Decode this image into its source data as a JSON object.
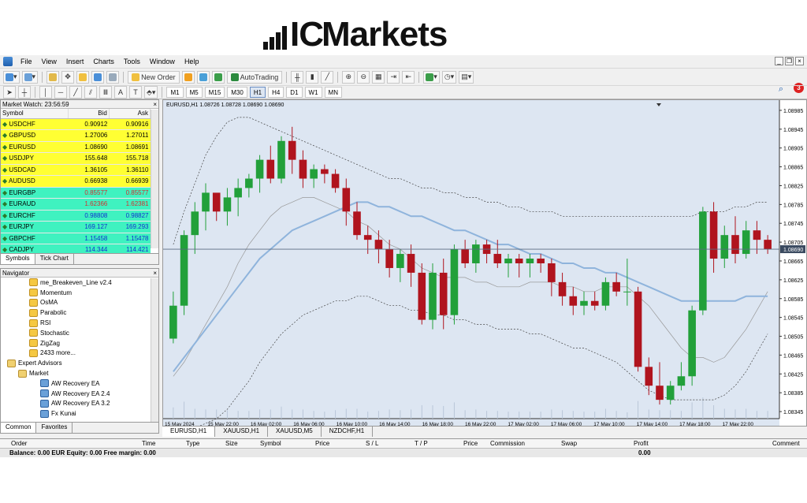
{
  "logo": {
    "prefix": "IC",
    "text": "Markets"
  },
  "menu": [
    "File",
    "View",
    "Insert",
    "Charts",
    "Tools",
    "Window",
    "Help"
  ],
  "toolbar": {
    "new_order": "New Order",
    "auto_trading": "AutoTrading"
  },
  "timeframes": [
    "M1",
    "M5",
    "M15",
    "M30",
    "H1",
    "H4",
    "D1",
    "W1",
    "MN"
  ],
  "active_timeframe": "H1",
  "market_watch": {
    "title": "Market Watch: 23:56:59",
    "headers": {
      "symbol": "Symbol",
      "bid": "Bid",
      "ask": "Ask"
    },
    "rows": [
      {
        "symbol": "USDCHF",
        "bid": "0.90912",
        "ask": "0.90916",
        "bg": "#ffff33",
        "fg": "#000"
      },
      {
        "symbol": "GBPUSD",
        "bid": "1.27006",
        "ask": "1.27011",
        "bg": "#ffff33",
        "fg": "#000"
      },
      {
        "symbol": "EURUSD",
        "bid": "1.08690",
        "ask": "1.08691",
        "bg": "#ffff33",
        "fg": "#000"
      },
      {
        "symbol": "USDJPY",
        "bid": "155.648",
        "ask": "155.718",
        "bg": "#ffff33",
        "fg": "#000"
      },
      {
        "symbol": "USDCAD",
        "bid": "1.36105",
        "ask": "1.36110",
        "bg": "#ffff33",
        "fg": "#000"
      },
      {
        "symbol": "AUDUSD",
        "bid": "0.66938",
        "ask": "0.66939",
        "bg": "#ffff33",
        "fg": "#000"
      },
      {
        "symbol": "EURGBP",
        "bid": "0.85577",
        "ask": "0.85577",
        "bg": "#3ff2c0",
        "fg": "#d03030"
      },
      {
        "symbol": "EURAUD",
        "bid": "1.62366",
        "ask": "1.62381",
        "bg": "#3ff2c0",
        "fg": "#d03030"
      },
      {
        "symbol": "EURCHF",
        "bid": "0.98808",
        "ask": "0.98827",
        "bg": "#3ff2c0",
        "fg": "#1030d0"
      },
      {
        "symbol": "EURJPY",
        "bid": "169.127",
        "ask": "169.293",
        "bg": "#3ff2c0",
        "fg": "#1030d0"
      },
      {
        "symbol": "GBPCHF",
        "bid": "1.15458",
        "ask": "1.15478",
        "bg": "#3ff2c0",
        "fg": "#1030d0"
      },
      {
        "symbol": "CADJPY",
        "bid": "114.344",
        "ask": "114.421",
        "bg": "#3ff2c0",
        "fg": "#1030d0"
      }
    ],
    "tabs": [
      "Symbols",
      "Tick Chart"
    ]
  },
  "navigator": {
    "title": "Navigator",
    "items": [
      {
        "label": "me_Breakeven_Line v2.4",
        "indent": 36,
        "type": "ind"
      },
      {
        "label": "Momentum",
        "indent": 36,
        "type": "ind"
      },
      {
        "label": "OsMA",
        "indent": 36,
        "type": "ind"
      },
      {
        "label": "Parabolic",
        "indent": 36,
        "type": "ind"
      },
      {
        "label": "RSI",
        "indent": 36,
        "type": "ind"
      },
      {
        "label": "Stochastic",
        "indent": 36,
        "type": "ind"
      },
      {
        "label": "ZigZag",
        "indent": 36,
        "type": "ind"
      },
      {
        "label": "2433 more...",
        "indent": 36,
        "type": "ind"
      },
      {
        "label": "Expert Advisors",
        "indent": 8,
        "type": "fold"
      },
      {
        "label": "Market",
        "indent": 22,
        "type": "fold"
      },
      {
        "label": "AW Recovery EA",
        "indent": 50,
        "type": "ea"
      },
      {
        "label": "AW Recovery EA 2.4",
        "indent": 50,
        "type": "ea"
      },
      {
        "label": "AW Recovery EA 3.2",
        "indent": 50,
        "type": "ea"
      },
      {
        "label": "Fx Kunai",
        "indent": 50,
        "type": "ea"
      }
    ],
    "tabs": [
      "Common",
      "Favorites"
    ]
  },
  "chart": {
    "title": "EURUSD,H1  1.08726 1.08728 1.08690 1.08690",
    "price_labels": [
      "1.08985",
      "1.08945",
      "1.08905",
      "1.08865",
      "1.08825",
      "1.08785",
      "1.08745",
      "1.08705",
      "1.08665",
      "1.08625",
      "1.08585",
      "1.08545",
      "1.08505",
      "1.08465",
      "1.08425",
      "1.08385",
      "1.08345"
    ],
    "current_price": "1.08690",
    "time_labels": [
      "15 May 2024",
      "15 May 22:00",
      "16 May 02:00",
      "16 May 06:00",
      "16 May 10:00",
      "16 May 14:00",
      "16 May 18:00",
      "16 May 22:00",
      "17 May 02:00",
      "17 May 06:00",
      "17 May 10:00",
      "17 May 14:00",
      "17 May 18:00",
      "17 May 22:00"
    ],
    "colors": {
      "bg": "#dde6f2",
      "bull": "#22a03a",
      "bear": "#b0141e",
      "ma": "#8fb4dc"
    },
    "tabs": [
      "EURUSD,H1",
      "XAUUSD,H1",
      "XAUUSD,M5",
      "NZDCHF,H1"
    ]
  },
  "chart_data": {
    "type": "line",
    "symbol": "EURUSD",
    "timeframe": "H1",
    "ylim": [
      1.0833,
      1.09
    ],
    "candles": [
      [
        1.085,
        1.086,
        1.0849,
        1.0857
      ],
      [
        1.0857,
        1.0873,
        1.0855,
        1.0872
      ],
      [
        1.0872,
        1.0879,
        1.0868,
        1.0877
      ],
      [
        1.0877,
        1.0883,
        1.0873,
        1.0881
      ],
      [
        1.0881,
        1.088,
        1.0875,
        1.0877
      ],
      [
        1.0877,
        1.0882,
        1.0874,
        1.088
      ],
      [
        1.088,
        1.0884,
        1.0876,
        1.0882
      ],
      [
        1.0882,
        1.0885,
        1.088,
        1.0884
      ],
      [
        1.0884,
        1.0889,
        1.0881,
        1.0888
      ],
      [
        1.0888,
        1.0891,
        1.0883,
        1.0884
      ],
      [
        1.0884,
        1.0893,
        1.0883,
        1.0892
      ],
      [
        1.0892,
        1.0895,
        1.0885,
        1.0888
      ],
      [
        1.0888,
        1.089,
        1.0882,
        1.0884
      ],
      [
        1.0884,
        1.0887,
        1.0882,
        1.0886
      ],
      [
        1.0886,
        1.0887,
        1.0883,
        1.0885
      ],
      [
        1.0885,
        1.0886,
        1.0881,
        1.0882
      ],
      [
        1.0882,
        1.0884,
        1.0874,
        1.0877
      ],
      [
        1.0877,
        1.0879,
        1.0871,
        1.0872
      ],
      [
        1.0872,
        1.0874,
        1.0868,
        1.0871
      ],
      [
        1.0871,
        1.0873,
        1.0866,
        1.0869
      ],
      [
        1.0869,
        1.0871,
        1.0863,
        1.0865
      ],
      [
        1.0865,
        1.0869,
        1.0862,
        1.0868
      ],
      [
        1.0868,
        1.087,
        1.0861,
        1.0864
      ],
      [
        1.0864,
        1.0866,
        1.0853,
        1.0854
      ],
      [
        1.0854,
        1.0866,
        1.0852,
        1.0864
      ],
      [
        1.0864,
        1.0867,
        1.0852,
        1.0855
      ],
      [
        1.0855,
        1.087,
        1.0853,
        1.0869
      ],
      [
        1.0869,
        1.0871,
        1.0865,
        1.0866
      ],
      [
        1.0866,
        1.0871,
        1.0864,
        1.087
      ],
      [
        1.087,
        1.0871,
        1.0866,
        1.0868
      ],
      [
        1.0868,
        1.0871,
        1.0865,
        1.0866
      ],
      [
        1.0866,
        1.0868,
        1.0863,
        1.0867
      ],
      [
        1.0867,
        1.0868,
        1.0863,
        1.0866
      ],
      [
        1.0866,
        1.0868,
        1.0863,
        1.0867
      ],
      [
        1.0867,
        1.0868,
        1.0864,
        1.0866
      ],
      [
        1.0866,
        1.0867,
        1.0859,
        1.0862
      ],
      [
        1.0862,
        1.0864,
        1.0857,
        1.0859
      ],
      [
        1.0859,
        1.0861,
        1.0855,
        1.0857
      ],
      [
        1.0857,
        1.086,
        1.0855,
        1.0858
      ],
      [
        1.0858,
        1.086,
        1.0856,
        1.0857
      ],
      [
        1.0857,
        1.0863,
        1.0856,
        1.0862
      ],
      [
        1.0862,
        1.0864,
        1.0859,
        1.086
      ],
      [
        1.086,
        1.0867,
        1.0857,
        1.086
      ],
      [
        1.086,
        1.0861,
        1.0843,
        1.0844
      ],
      [
        1.0844,
        1.0846,
        1.0838,
        1.084
      ],
      [
        1.084,
        1.0845,
        1.0836,
        1.0837
      ],
      [
        1.0837,
        1.0841,
        1.0836,
        1.084
      ],
      [
        1.084,
        1.0845,
        1.0839,
        1.0842
      ],
      [
        1.0842,
        1.0857,
        1.084,
        1.0856
      ],
      [
        1.0856,
        1.0878,
        1.0855,
        1.0877
      ],
      [
        1.0877,
        1.0879,
        1.0864,
        1.0867
      ],
      [
        1.0867,
        1.0874,
        1.0865,
        1.0872
      ],
      [
        1.0872,
        1.0876,
        1.0866,
        1.0868
      ],
      [
        1.0868,
        1.0875,
        1.0867,
        1.0873
      ],
      [
        1.0873,
        1.0875,
        1.0868,
        1.0871
      ],
      [
        1.0871,
        1.0872,
        1.0868,
        1.0869
      ]
    ],
    "sma": [
      1.0843,
      1.0846,
      1.0849,
      1.0852,
      1.0855,
      1.0858,
      1.0861,
      1.0864,
      1.0867,
      1.0869,
      1.0871,
      1.0873,
      1.0874,
      1.0875,
      1.0876,
      1.0877,
      1.0878,
      1.0879,
      1.0879,
      1.0878,
      1.0878,
      1.0877,
      1.0876,
      1.0876,
      1.0875,
      1.0874,
      1.0873,
      1.0873,
      1.0872,
      1.0871,
      1.087,
      1.087,
      1.0869,
      1.0868,
      1.0868,
      1.0867,
      1.0866,
      1.0866,
      1.0865,
      1.0865,
      1.0864,
      1.0864,
      1.0863,
      1.0862,
      1.0861,
      1.086,
      1.0859,
      1.0858,
      1.0858,
      1.0858,
      1.0858,
      1.0858,
      1.0858,
      1.0859,
      1.0859,
      1.0859
    ],
    "bb_upper": [
      1.087,
      1.0877,
      1.0883,
      1.0889,
      1.0893,
      1.0896,
      1.0897,
      1.0897,
      1.0896,
      1.0895,
      1.0894,
      1.0893,
      1.0892,
      1.0891,
      1.089,
      1.0889,
      1.0888,
      1.0887,
      1.0886,
      1.0885,
      1.0884,
      1.0884,
      1.0883,
      1.0882,
      1.0882,
      1.0881,
      1.0881,
      1.088,
      1.088,
      1.0879,
      1.0879,
      1.0878,
      1.0878,
      1.0877,
      1.0877,
      1.0877,
      1.0876,
      1.0876,
      1.0876,
      1.0876,
      1.0876,
      1.0876,
      1.0876,
      1.0876,
      1.0876,
      1.0876,
      1.0876,
      1.0876,
      1.0876,
      1.0877,
      1.0877,
      1.0877,
      1.0878,
      1.0878,
      1.0879,
      1.0879
    ],
    "bb_lower": [
      1.083,
      1.083,
      1.0831,
      1.0832,
      1.0833,
      1.0835,
      1.0838,
      1.0841,
      1.0845,
      1.0848,
      1.0851,
      1.0853,
      1.0855,
      1.0856,
      1.0857,
      1.0858,
      1.0858,
      1.0859,
      1.0859,
      1.0858,
      1.0857,
      1.0857,
      1.0856,
      1.0856,
      1.0855,
      1.0855,
      1.0854,
      1.0854,
      1.0853,
      1.0853,
      1.0852,
      1.0852,
      1.0852,
      1.0851,
      1.0851,
      1.085,
      1.0849,
      1.0848,
      1.0848,
      1.0847,
      1.0846,
      1.0845,
      1.0843,
      1.0841,
      1.0839,
      1.0838,
      1.0837,
      1.0837,
      1.0837,
      1.0837,
      1.0837,
      1.0838,
      1.084,
      1.0843,
      1.0847,
      1.0851
    ],
    "bb_mid": [
      1.0842,
      1.0845,
      1.0849,
      1.0853,
      1.0857,
      1.0861,
      1.0866,
      1.087,
      1.0873,
      1.0876,
      1.0878,
      1.0879,
      1.088,
      1.088,
      1.0879,
      1.0878,
      1.0877,
      1.0875,
      1.0874,
      1.0872,
      1.087,
      1.0869,
      1.0867,
      1.0865,
      1.0864,
      1.0863,
      1.0863,
      1.0863,
      1.0862,
      1.0862,
      1.0861,
      1.0861,
      1.0861,
      1.0862,
      1.0862,
      1.0862,
      1.0861,
      1.0861,
      1.086,
      1.086,
      1.0861,
      1.0861,
      1.0861,
      1.0859,
      1.0857,
      1.0854,
      1.0851,
      1.0848,
      1.0846,
      1.0846,
      1.0845,
      1.0846,
      1.0849,
      1.0852,
      1.0856,
      1.086
    ]
  },
  "terminal": {
    "headers": [
      "Order",
      "Time",
      "Type",
      "Size",
      "Symbol",
      "Price",
      "S / L",
      "T / P",
      "Price",
      "Commission",
      "Swap",
      "Profit",
      "Comment"
    ],
    "balance": "Balance: 0.00 EUR  Equity: 0.00  Free margin: 0.00",
    "profit": "0.00"
  }
}
